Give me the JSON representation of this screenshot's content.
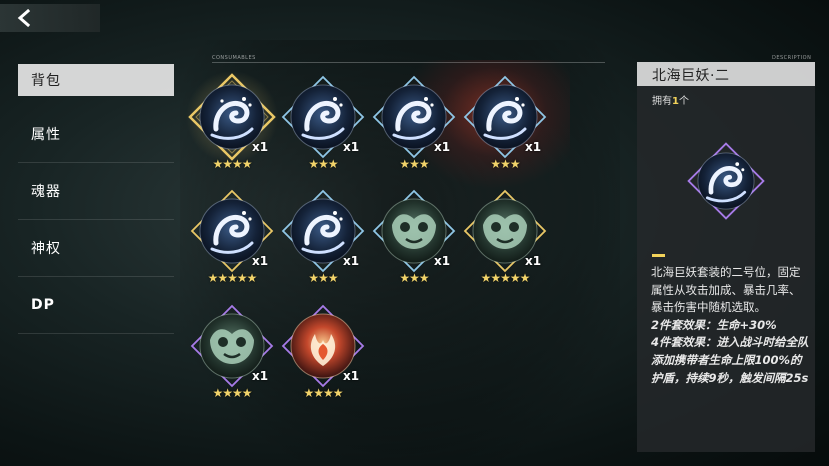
{
  "colors": {
    "star": "#f1d36a",
    "highlight": "#f2d25a",
    "frame_gold": "#e9c766",
    "frame_blue": "#8fc6e6",
    "frame_purple": "#a77be8"
  },
  "nav": {
    "back_icon": "chevron-left-icon"
  },
  "sidebar": {
    "items": [
      {
        "label": "背包",
        "active": true
      },
      {
        "label": "属性"
      },
      {
        "label": "魂器"
      },
      {
        "label": "神权"
      },
      {
        "label": "DP"
      }
    ]
  },
  "sections": {
    "consumables": "CONSUMABLES",
    "description": "DESCRIPTION"
  },
  "items": [
    {
      "icon": "sea-wave-icon",
      "frame": "gold",
      "qty": "x1",
      "stars": "★★★★",
      "selected": true
    },
    {
      "icon": "sea-wave-icon",
      "frame": "blue",
      "qty": "x1",
      "stars": "★★★"
    },
    {
      "icon": "sea-wave-icon",
      "frame": "blue",
      "qty": "x1",
      "stars": "★★★"
    },
    {
      "icon": "sea-wave-icon",
      "frame": "blue",
      "qty": "x1",
      "stars": "★★★"
    },
    {
      "icon": "sea-wave-icon",
      "frame": "gold",
      "qty": "x1",
      "stars": "★★★★★"
    },
    {
      "icon": "sea-wave-icon",
      "frame": "blue",
      "qty": "x1",
      "stars": "★★★"
    },
    {
      "icon": "jade-mask-icon",
      "frame": "blue",
      "qty": "x1",
      "stars": "★★★"
    },
    {
      "icon": "jade-mask-icon",
      "frame": "gold",
      "qty": "x1",
      "stars": "★★★★★"
    },
    {
      "icon": "jade-mask-icon",
      "frame": "purple",
      "qty": "x1",
      "stars": "★★★★"
    },
    {
      "icon": "phoenix-flame-icon",
      "frame": "purple",
      "qty": "x1",
      "stars": "★★★★"
    }
  ],
  "detail": {
    "title": "北海巨妖·二",
    "owned_prefix": "拥有",
    "owned_count": "1",
    "owned_suffix": "个",
    "icon": "sea-wave-icon",
    "description": "北海巨妖套装的二号位，固定属性从攻击加成、暴击几率、暴击伤害中随机选取。",
    "set2": "2件套效果：生命+30%",
    "set4_a": "4件套效果：进入战斗时给全队添加携带者生命上限",
    "set4_b": "100%的护盾，持续9秒，触发间隔25s"
  }
}
